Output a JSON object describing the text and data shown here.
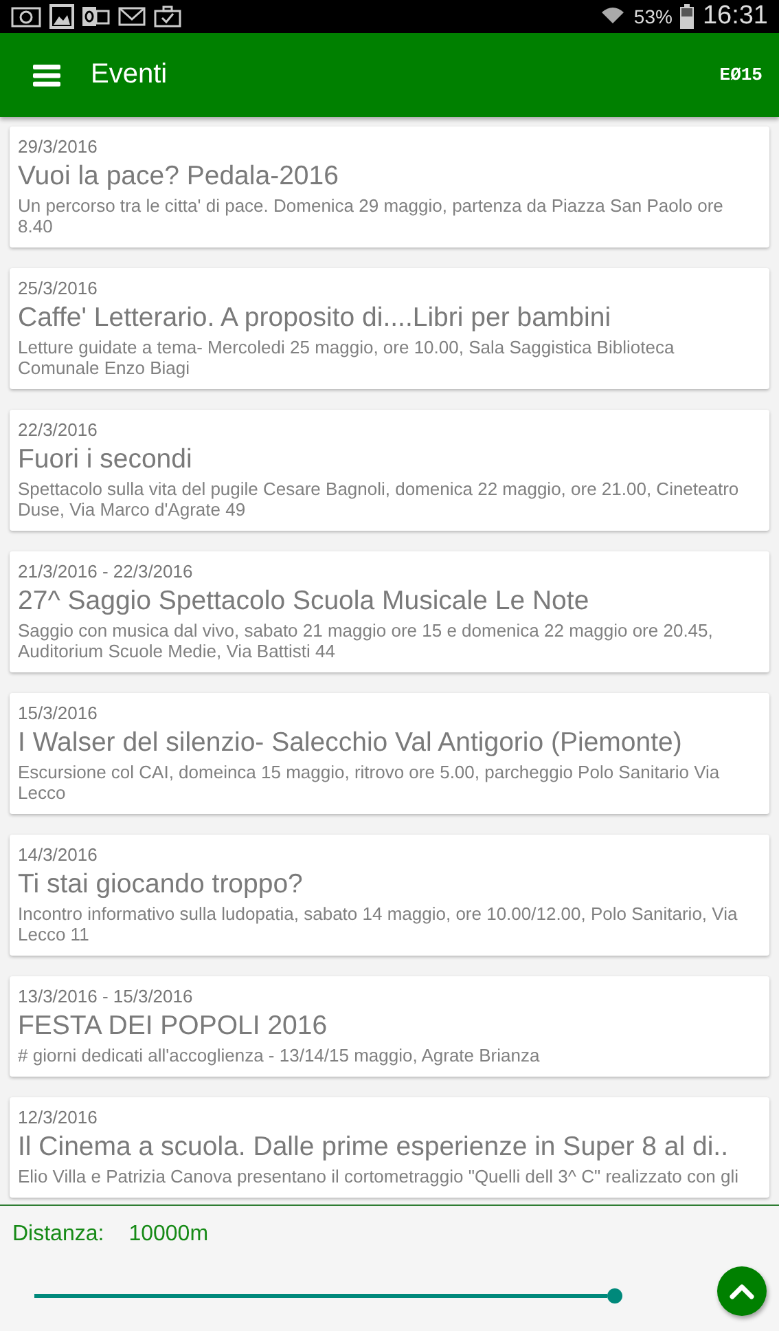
{
  "status_bar": {
    "battery": "53%",
    "time": "16:31"
  },
  "app_bar": {
    "title": "Eventi",
    "badge": "EØ15"
  },
  "events": [
    {
      "date": "29/3/2016",
      "title": "Vuoi la pace? Pedala-2016",
      "description": "Un percorso tra le citta' di pace. Domenica 29 maggio, partenza da Piazza San Paolo ore 8.40"
    },
    {
      "date": "25/3/2016",
      "title": "Caffe' Letterario. A proposito di....Libri per bambini",
      "description": "Letture guidate a tema- Mercoledi 25 maggio, ore 10.00, Sala Saggistica Biblioteca Comunale Enzo Biagi"
    },
    {
      "date": "22/3/2016",
      "title": "Fuori i secondi",
      "description": "Spettacolo sulla vita del pugile Cesare Bagnoli, domenica 22 maggio, ore 21.00, Cineteatro Duse, Via Marco d'Agrate 49"
    },
    {
      "date": "21/3/2016 - 22/3/2016",
      "title": "27^ Saggio Spettacolo Scuola Musicale Le Note",
      "description": "Saggio con musica dal vivo, sabato 21 maggio ore 15 e domenica 22 maggio ore 20.45, Auditorium Scuole Medie, Via Battisti 44"
    },
    {
      "date": "15/3/2016",
      "title": "I Walser del silenzio- Salecchio Val Antigorio (Piemonte)",
      "description": "Escursione col CAI, domeinca 15 maggio, ritrovo ore 5.00, parcheggio Polo Sanitario Via Lecco"
    },
    {
      "date": "14/3/2016",
      "title": "Ti stai giocando troppo?",
      "description": "Incontro informativo sulla ludopatia, sabato 14 maggio, ore 10.00/12.00, Polo Sanitario, Via Lecco 11"
    },
    {
      "date": "13/3/2016 - 15/3/2016",
      "title": "FESTA DEI POPOLI 2016",
      "description": "# giorni dedicati all'accoglienza - 13/14/15 maggio, Agrate Brianza"
    },
    {
      "date": "12/3/2016",
      "title": "Il Cinema a scuola. Dalle prime esperienze in Super 8 al di..",
      "description": "Elio Villa e Patrizia Canova presentano il cortometraggio \"Quelli dell 3^ C\" realizzato con gli"
    }
  ],
  "distance": {
    "label": "Distanza:",
    "value": "10000m",
    "level": 1
  }
}
